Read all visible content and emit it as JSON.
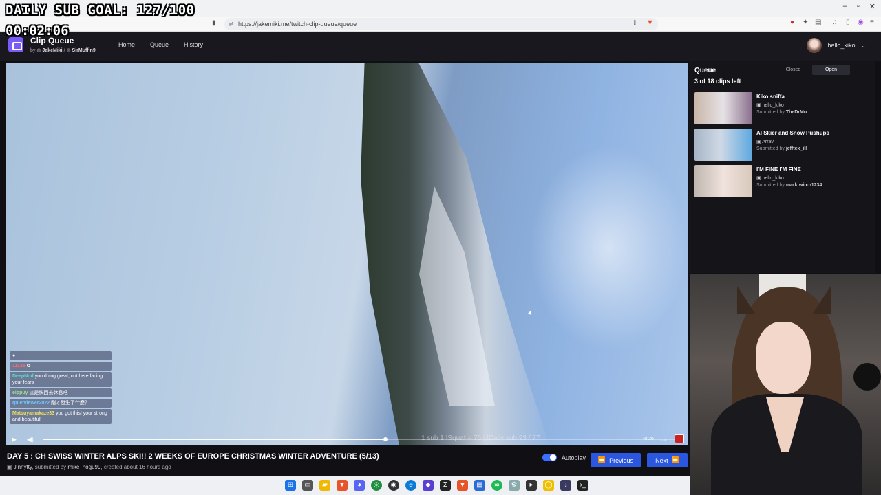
{
  "overlay": {
    "sub_goal": "DAILY SUB GOAL: 127/100",
    "timer": "00:02:06"
  },
  "browser": {
    "url": "https://jakemiki.me/twitch-clip-queue/queue"
  },
  "app": {
    "title": "Clip Queue",
    "by_prefix": "by",
    "author1": "JakeMiki",
    "separator": "/",
    "author2": "SirMuffin9",
    "nav": [
      "Home",
      "Queue",
      "History"
    ],
    "active_nav": "Queue",
    "username": "hello_kiko",
    "user_chevron": "⌄"
  },
  "chat": [
    {
      "name": "",
      "text": "",
      "color": "#e04040"
    },
    {
      "name": "11136",
      "text": "",
      "color": "#ff6b6b"
    },
    {
      "name": "DeepNod",
      "text": "you doing great, out here facing your fears",
      "color": "#5be0c8"
    },
    {
      "name": "eippuy",
      "text": "這是快回去休息吧",
      "color": "#9ee08a"
    },
    {
      "name": "quietviewer2022",
      "text": "剛才發生了什麼？",
      "color": "#6ec6ff"
    },
    {
      "name": "Matsuyamakaze33",
      "text": "you got this! your strong and beautiful!",
      "color": "#f0e060"
    }
  ],
  "player": {
    "time": "-0:26",
    "ghost_text": "1 sub 1 !Squat = 75 | !Daily sub 93 / 77",
    "progress": 0.54
  },
  "video": {
    "title": "DAY 5 : CH SWISS WINTER ALPS SKI!! 2 WEEKS OF EUROPE CHRISTMAS WINTER ADVENTURE (5/13)",
    "channel": "Jinnytty",
    "meta_mid": ", submitted by",
    "submitter": "mike_hogu99",
    "created": ", created about 16 hours ago",
    "autoplay_label": "Autoplay",
    "prev_label": "Previous",
    "next_label": "Next"
  },
  "queue": {
    "title": "Queue",
    "left": "3 of 18 clips left",
    "closed_label": "Closed",
    "open_label": "Open",
    "menu": "⋯",
    "items": [
      {
        "name": "Kiko sniffa",
        "channel": "hello_kiko",
        "submitted_prefix": "Submitted by",
        "submitter": "TheDrMo"
      },
      {
        "name": "AI Skier and Snow Pushups",
        "channel": "Arrav",
        "submitted_prefix": "Submitted by",
        "submitter": "jefftex_ill"
      },
      {
        "name": "I'M FINE I'M FINE",
        "channel": "hello_kiko",
        "submitted_prefix": "Submitted by",
        "submitter": "marktwitch1234"
      }
    ]
  },
  "colors": {
    "accent": "#2a56e0",
    "brand": "#7a5af8",
    "bg": "#0f0f14"
  }
}
